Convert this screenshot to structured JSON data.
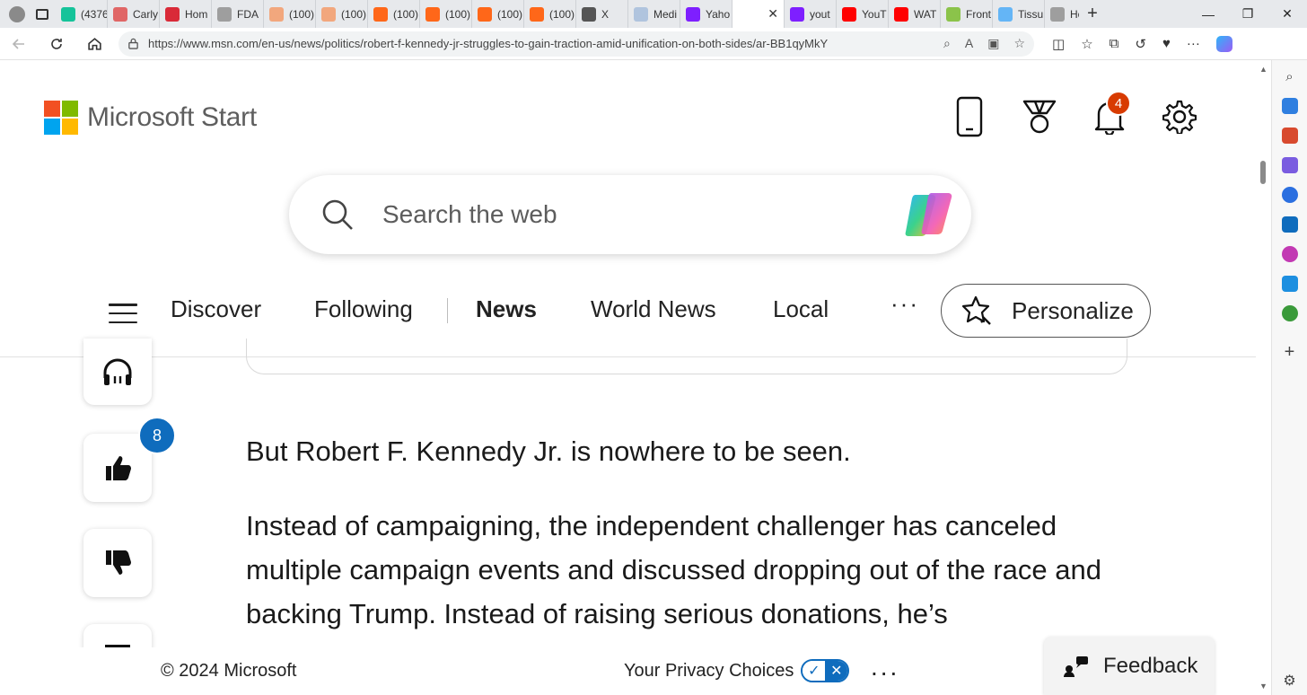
{
  "browser": {
    "tabs": [
      {
        "label": "(4376",
        "icon": "grammarly-icon",
        "color": "#15c39a"
      },
      {
        "label": "Carly",
        "icon": "youtube-icon",
        "color": "#e06666"
      },
      {
        "label": "Hom",
        "icon": "pocket-icon",
        "color": "#d92a38"
      },
      {
        "label": "FDA",
        "icon": "document-icon",
        "color": "#9e9e9e"
      },
      {
        "label": "(100)",
        "icon": "substack-icon",
        "color": "#f2a77d"
      },
      {
        "label": "(100)",
        "icon": "substack-icon",
        "color": "#f2a77d"
      },
      {
        "label": "(100)",
        "icon": "substack-icon",
        "color": "#ff6719"
      },
      {
        "label": "(100)",
        "icon": "substack-icon",
        "color": "#ff6719"
      },
      {
        "label": "(100)",
        "icon": "substack-icon",
        "color": "#ff6719"
      },
      {
        "label": "(100)",
        "icon": "substack-icon",
        "color": "#ff6719"
      },
      {
        "label": "X",
        "icon": "x-icon",
        "color": "#555555"
      },
      {
        "label": "Medi",
        "icon": "globe-icon",
        "color": "#b0c4de"
      },
      {
        "label": "Yaho",
        "icon": "yahoo-icon",
        "color": "#7e1fff"
      },
      {
        "label": "",
        "icon": "msn-icon",
        "color": "#ffffff",
        "active": true
      },
      {
        "label": "yout",
        "icon": "yahoo-icon",
        "color": "#7e1fff"
      },
      {
        "label": "YouT",
        "icon": "youtube-icon",
        "color": "#ff0000"
      },
      {
        "label": "WAT",
        "icon": "youtube-icon",
        "color": "#ff0000"
      },
      {
        "label": "Front",
        "icon": "globe-icon",
        "color": "#8bc34a"
      },
      {
        "label": "Tissu",
        "icon": "globe-icon",
        "color": "#64b5f6"
      },
      {
        "label": "How",
        "icon": "globe-icon",
        "color": "#9e9e9e"
      }
    ],
    "active_tab_close": "✕",
    "new_tab": "+",
    "window_controls": {
      "minimize": "—",
      "maximize": "❐",
      "close": "✕"
    },
    "url": "https://www.msn.com/en-us/news/politics/robert-f-kennedy-jr-struggles-to-gain-traction-amid-unification-on-both-sides/ar-BB1qyMkY"
  },
  "page": {
    "logo_text": "Microsoft Start",
    "notification_count": "4",
    "search_placeholder": "Search the web",
    "nav": {
      "items": [
        "Discover",
        "Following",
        "News",
        "World News",
        "Local"
      ],
      "active": "News",
      "more": "···",
      "personalize": "Personalize"
    },
    "like_count": "8",
    "article": {
      "para1": "But Robert F. Kennedy Jr. is nowhere to be seen.",
      "para2": "Instead of campaigning, the independent challenger has canceled multiple campaign events and discussed dropping out of the race and backing Trump. Instead of raising serious donations, he’s"
    },
    "footer": {
      "copyright": "© 2024 Microsoft",
      "privacy": "Your Privacy Choices",
      "more": "...",
      "feedback": "Feedback"
    }
  },
  "colors": {
    "ms_red": "#f25022",
    "ms_green": "#7fba00",
    "ms_blue": "#00a4ef",
    "ms_yellow": "#ffb900",
    "badge_orange": "#d83b01",
    "like_blue": "#0f6cbd"
  }
}
